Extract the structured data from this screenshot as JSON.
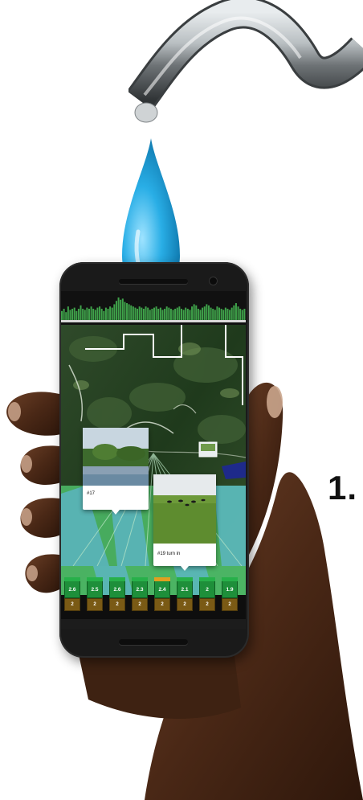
{
  "headline_number": "1.",
  "screen": {
    "cards": [
      {
        "caption": "#17"
      },
      {
        "caption": "#19 turn in"
      }
    ],
    "bars": [
      {
        "value": "2.6",
        "sub": "2"
      },
      {
        "value": "2.5",
        "sub": "2"
      },
      {
        "value": "2.6",
        "sub": "2"
      },
      {
        "value": "2.3",
        "sub": "2"
      },
      {
        "value": "2.4",
        "sub": "2"
      },
      {
        "value": "2.1",
        "sub": "2"
      },
      {
        "value": "2",
        "sub": "2"
      },
      {
        "value": "1.9",
        "sub": "2"
      }
    ],
    "histogram_levels": [
      0.4,
      0.5,
      0.35,
      0.6,
      0.45,
      0.5,
      0.55,
      0.4,
      0.5,
      0.65,
      0.5,
      0.45,
      0.55,
      0.5,
      0.6,
      0.5,
      0.45,
      0.55,
      0.6,
      0.5,
      0.4,
      0.55,
      0.5,
      0.6,
      0.55,
      0.7,
      0.85,
      1.0,
      0.9,
      0.95,
      0.8,
      0.75,
      0.7,
      0.65,
      0.6,
      0.55,
      0.5,
      0.6,
      0.55,
      0.5,
      0.6,
      0.55,
      0.45,
      0.5,
      0.55,
      0.6,
      0.5,
      0.55,
      0.45,
      0.5,
      0.6,
      0.55,
      0.5,
      0.45,
      0.5,
      0.55,
      0.6,
      0.5,
      0.45,
      0.55,
      0.5,
      0.45,
      0.6,
      0.7,
      0.65,
      0.5,
      0.45,
      0.55,
      0.6,
      0.7,
      0.65,
      0.55,
      0.5,
      0.45,
      0.6,
      0.55,
      0.5,
      0.45,
      0.55,
      0.5,
      0.45,
      0.55,
      0.65,
      0.75,
      0.6,
      0.5,
      0.45,
      0.5
    ],
    "colors": {
      "histogram": "#3fa24a",
      "field_green": "#4fc06a",
      "field_blue": "#5fb7d6",
      "bar_green": "#1e8f3a",
      "bar_brown": "#7a5a15"
    }
  },
  "colors": {
    "droplet": "#22a7e0",
    "faucet": "#9aa0a4"
  }
}
